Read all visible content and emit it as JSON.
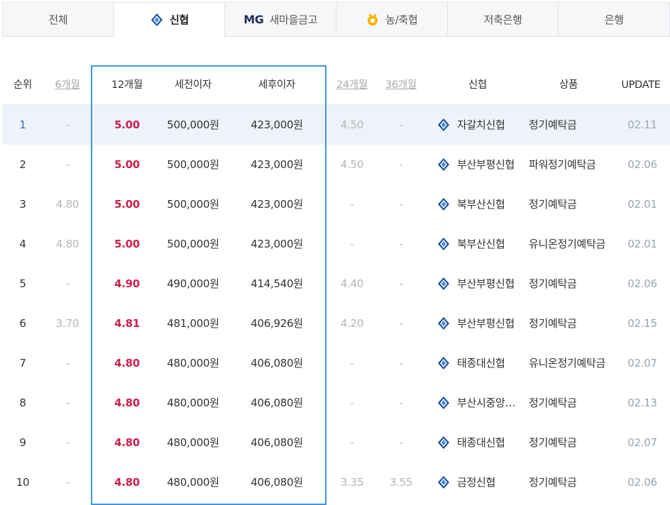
{
  "tabs": [
    {
      "label": "전체",
      "icon": ""
    },
    {
      "label": "신협",
      "icon": "shinhyup-logo-icon"
    },
    {
      "label": "새마을금고",
      "icon": "mg-logo",
      "prefix": "MG"
    },
    {
      "label": "농/축협",
      "icon": "nonghyup-logo-icon"
    },
    {
      "label": "저축은행",
      "icon": ""
    },
    {
      "label": "은행",
      "icon": ""
    }
  ],
  "active_tab": 1,
  "colors": {
    "accent": "#3d97e0",
    "rate": "#cc1f4e",
    "selected_row": "#eef3fb"
  },
  "columns": {
    "rank": "순위",
    "m6": "6개월",
    "m12": "12개월",
    "pretax": "세전이자",
    "aftertax": "세후이자",
    "m24": "24개월",
    "m36": "36개월",
    "bank": "신협",
    "product": "상품",
    "update": "UPDATE"
  },
  "rows": [
    {
      "rank": "1",
      "m6": "-",
      "m12": "5.00",
      "pretax": "500,000원",
      "aftertax": "423,000원",
      "m24": "4.50",
      "m36": "-",
      "bank": "자갈치신협",
      "product": "정기예탁금",
      "update": "02.11"
    },
    {
      "rank": "2",
      "m6": "-",
      "m12": "5.00",
      "pretax": "500,000원",
      "aftertax": "423,000원",
      "m24": "4.50",
      "m36": "-",
      "bank": "부산부평신협",
      "product": "파워정기예탁금",
      "update": "02.06"
    },
    {
      "rank": "3",
      "m6": "4.80",
      "m12": "5.00",
      "pretax": "500,000원",
      "aftertax": "423,000원",
      "m24": "-",
      "m36": "-",
      "bank": "북부산신협",
      "product": "정기예탁금",
      "update": "02.01"
    },
    {
      "rank": "4",
      "m6": "4.80",
      "m12": "5.00",
      "pretax": "500,000원",
      "aftertax": "423,000원",
      "m24": "-",
      "m36": "-",
      "bank": "북부산신협",
      "product": "유니온정기예탁금",
      "update": "02.01"
    },
    {
      "rank": "5",
      "m6": "-",
      "m12": "4.90",
      "pretax": "490,000원",
      "aftertax": "414,540원",
      "m24": "4.40",
      "m36": "-",
      "bank": "부산부평신협",
      "product": "정기예탁금",
      "update": "02.06"
    },
    {
      "rank": "6",
      "m6": "3.70",
      "m12": "4.81",
      "pretax": "481,000원",
      "aftertax": "406,926원",
      "m24": "4.20",
      "m36": "-",
      "bank": "부산부평신협",
      "product": "정기예탁금",
      "update": "02.15"
    },
    {
      "rank": "7",
      "m6": "-",
      "m12": "4.80",
      "pretax": "480,000원",
      "aftertax": "406,080원",
      "m24": "-",
      "m36": "-",
      "bank": "태종대신협",
      "product": "유니온정기예탁금",
      "update": "02.07"
    },
    {
      "rank": "8",
      "m6": "-",
      "m12": "4.80",
      "pretax": "480,000원",
      "aftertax": "406,080원",
      "m24": "-",
      "m36": "-",
      "bank": "부산시중앙…",
      "product": "정기예탁금",
      "update": "02.13"
    },
    {
      "rank": "9",
      "m6": "-",
      "m12": "4.80",
      "pretax": "480,000원",
      "aftertax": "406,080원",
      "m24": "-",
      "m36": "-",
      "bank": "태종대신협",
      "product": "정기예탁금",
      "update": "02.07"
    },
    {
      "rank": "10",
      "m6": "-",
      "m12": "4.80",
      "pretax": "480,000원",
      "aftertax": "406,080원",
      "m24": "3.35",
      "m36": "3.55",
      "bank": "금정신협",
      "product": "정기예탁금",
      "update": "02.06"
    }
  ]
}
